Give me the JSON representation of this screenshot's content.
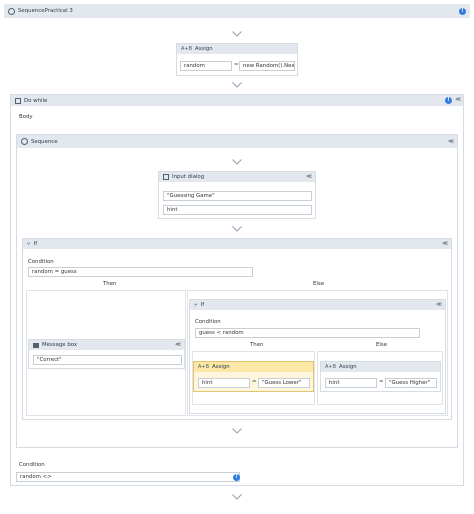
{
  "root": {
    "title": "SequencePractical 3"
  },
  "assign_top": {
    "title": "Assign",
    "to": "random",
    "value": "new Random().Nex"
  },
  "do_while": {
    "title": "Do while",
    "body_label": "Body",
    "condition_label": "Condition",
    "condition_value": "random <>"
  },
  "sequence": {
    "title": "Sequence"
  },
  "input_dialog": {
    "title": "Input dialog",
    "title_value": "\"Guessing Game\"",
    "result_value": "hint"
  },
  "if_outer": {
    "title": "If",
    "condition_label": "Condition",
    "condition_value": "random = guess",
    "then_label": "Then",
    "else_label": "Else"
  },
  "message_box": {
    "title": "Message box",
    "text_value": "\"Correct\""
  },
  "if_inner": {
    "title": "If",
    "condition_label": "Condition",
    "condition_value": "guess < random",
    "then_label": "Then",
    "else_label": "Else"
  },
  "assign_lower": {
    "title": "Assign",
    "to": "hint",
    "value": "\"Guess Lower\""
  },
  "assign_higher": {
    "title": "Assign",
    "to": "hint",
    "value": "\"Guess Higher\""
  },
  "symbols": {
    "equals": "=",
    "collapse": "≪",
    "info": "!"
  }
}
